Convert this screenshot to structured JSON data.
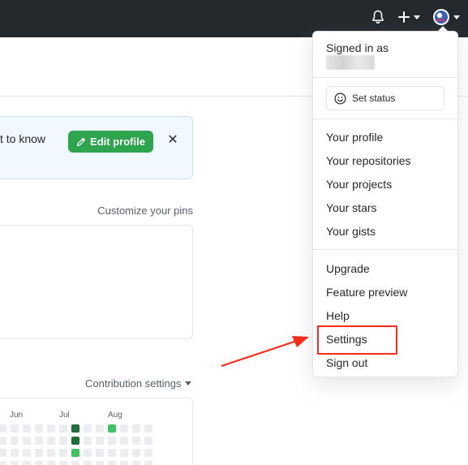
{
  "header": {
    "icons": [
      "bell-icon",
      "plus-icon",
      "avatar"
    ]
  },
  "banner": {
    "text": "t to know",
    "edit_label": "Edit profile",
    "close_symbol": "✕"
  },
  "pins": {
    "link": "Customize your pins"
  },
  "contributions": {
    "link": "Contribution settings",
    "months": [
      "Jun",
      "Jul",
      "Aug"
    ]
  },
  "dropdown": {
    "signed_in_label": "Signed in as",
    "set_status_label": "Set status",
    "group1": [
      "Your profile",
      "Your repositories",
      "Your projects",
      "Your stars",
      "Your gists"
    ],
    "group2": [
      "Upgrade",
      "Feature preview",
      "Help",
      "Settings",
      "Sign out"
    ]
  },
  "colors": {
    "header_bg": "#24292e",
    "green_button": "#2ea44f",
    "annotation_red": "#ff2a1a",
    "contrib_dark": "#216e39",
    "contrib_light": "#40c463"
  }
}
